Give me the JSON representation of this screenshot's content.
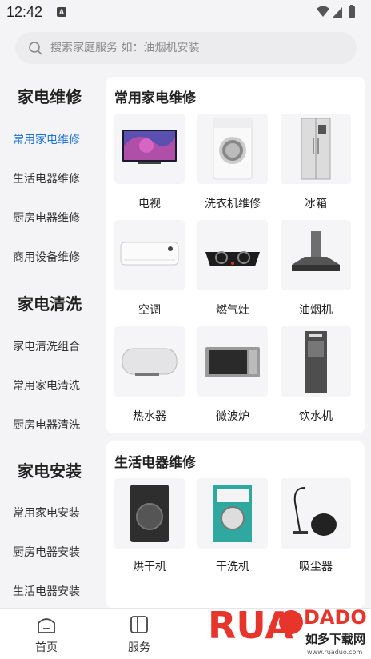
{
  "status_bar": {
    "time": "12:42",
    "notif_letter": "A"
  },
  "search": {
    "placeholder": "搜索家庭服务 如：油烟机安装"
  },
  "sidebar": {
    "groups": [
      {
        "title": "家电维修",
        "items": [
          "常用家电维修",
          "生活电器维修",
          "厨房电器维修",
          "商用设备维修"
        ]
      },
      {
        "title": "家电清洗",
        "items": [
          "家电清洗组合",
          "常用家电清洗",
          "厨房电器清洗"
        ]
      },
      {
        "title": "家电安装",
        "items": [
          "常用家电安装",
          "厨房电器安装",
          "生活电器安装"
        ]
      }
    ],
    "active_item": "常用家电维修"
  },
  "sections": [
    {
      "title": "常用家电维修",
      "items": [
        {
          "label": "电视",
          "icon": "tv-icon"
        },
        {
          "label": "洗衣机维修",
          "icon": "washing-machine-icon"
        },
        {
          "label": "冰箱",
          "icon": "fridge-icon"
        },
        {
          "label": "空调",
          "icon": "air-conditioner-icon"
        },
        {
          "label": "燃气灶",
          "icon": "gas-stove-icon"
        },
        {
          "label": "油烟机",
          "icon": "range-hood-icon"
        },
        {
          "label": "热水器",
          "icon": "water-heater-icon"
        },
        {
          "label": "微波炉",
          "icon": "microwave-icon"
        },
        {
          "label": "饮水机",
          "icon": "water-dispenser-icon"
        }
      ]
    },
    {
      "title": "生活电器维修",
      "items": [
        {
          "label": "烘干机",
          "icon": "dryer-icon"
        },
        {
          "label": "干洗机",
          "icon": "dry-cleaner-icon"
        },
        {
          "label": "吸尘器",
          "icon": "vacuum-icon"
        }
      ]
    }
  ],
  "bottom_nav": [
    {
      "label": "首页",
      "icon": "home-icon"
    },
    {
      "label": "服务",
      "icon": "service-icon"
    }
  ],
  "watermark": {
    "logo": "RUANDAO",
    "sub": "如多下载网",
    "url": "www.ruaduo.com"
  },
  "colors": {
    "accent": "#1f73d6",
    "background": "#f4f4f6",
    "watermark_red": "#e8352c"
  }
}
